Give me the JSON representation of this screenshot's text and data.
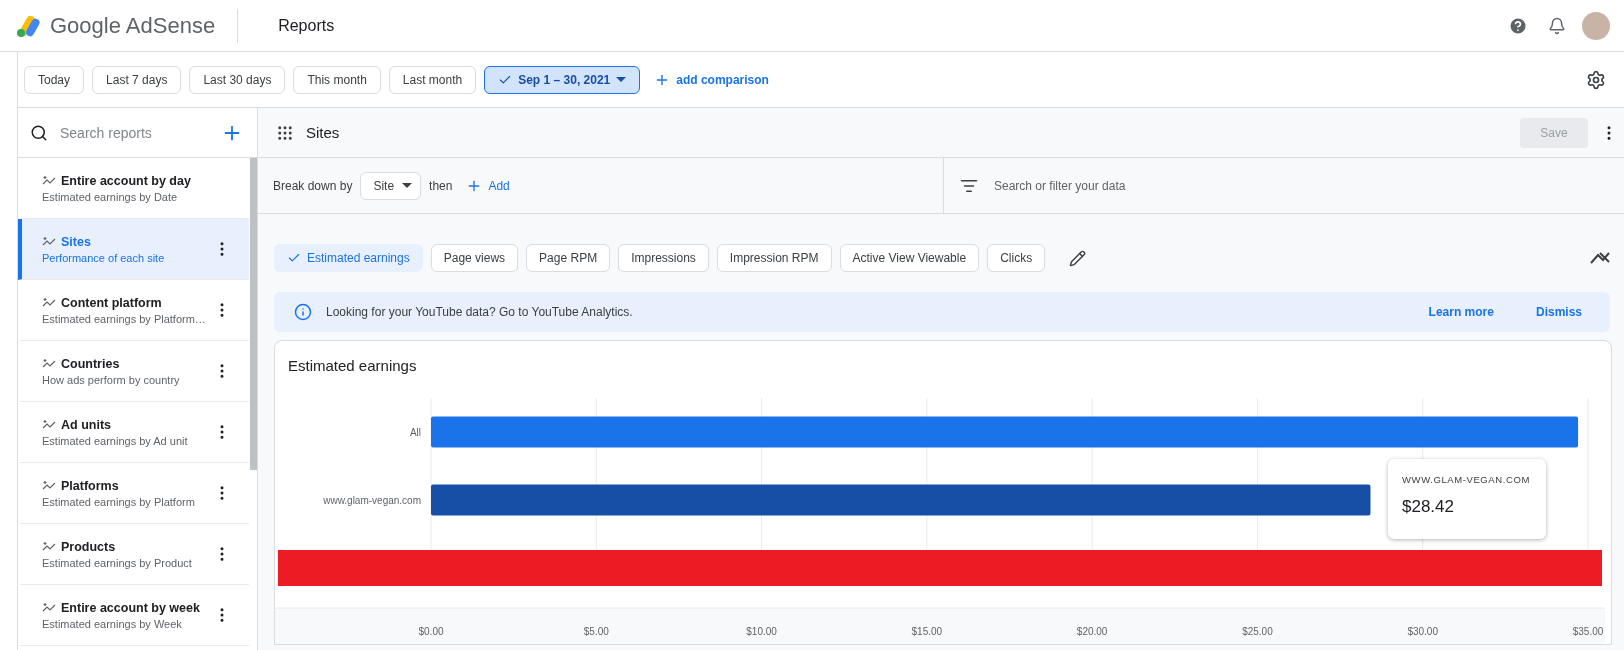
{
  "header": {
    "product": "Google AdSense",
    "page_title": "Reports"
  },
  "date_ranges": [
    {
      "label": "Today",
      "selected": false
    },
    {
      "label": "Last 7 days",
      "selected": false
    },
    {
      "label": "Last 30 days",
      "selected": false
    },
    {
      "label": "This month",
      "selected": false
    },
    {
      "label": "Last month",
      "selected": false
    },
    {
      "label": "Sep 1 – 30, 2021",
      "selected": true
    }
  ],
  "add_comparison": "add comparison",
  "sidebar": {
    "search": {
      "placeholder": "Search reports"
    },
    "items": [
      {
        "title": "Entire account by day",
        "subtitle": "Estimated earnings by Date",
        "selected": false,
        "has_menu": false
      },
      {
        "title": "Sites",
        "subtitle": "Performance of each site",
        "selected": true,
        "has_menu": true
      },
      {
        "title": "Content platform",
        "subtitle": "Estimated earnings by Platform…",
        "selected": false,
        "has_menu": true
      },
      {
        "title": "Countries",
        "subtitle": "How ads perform by country",
        "selected": false,
        "has_menu": true
      },
      {
        "title": "Ad units",
        "subtitle": "Estimated earnings by Ad unit",
        "selected": false,
        "has_menu": true
      },
      {
        "title": "Platforms",
        "subtitle": "Estimated earnings by Platform",
        "selected": false,
        "has_menu": true
      },
      {
        "title": "Products",
        "subtitle": "Estimated earnings by Product",
        "selected": false,
        "has_menu": true
      },
      {
        "title": "Entire account by week",
        "subtitle": "Estimated earnings by Week",
        "selected": false,
        "has_menu": true
      }
    ]
  },
  "report": {
    "title": "Sites",
    "save": {
      "label": "Save",
      "disabled": true
    },
    "breakdown": {
      "label": "Break down by",
      "value": "Site",
      "then": "then",
      "add": "Add"
    },
    "filter": {
      "placeholder": "Search or filter your data"
    },
    "metrics": [
      {
        "label": "Estimated earnings",
        "selected": true
      },
      {
        "label": "Page views",
        "selected": false
      },
      {
        "label": "Page RPM",
        "selected": false
      },
      {
        "label": "Impressions",
        "selected": false
      },
      {
        "label": "Impression RPM",
        "selected": false
      },
      {
        "label": "Active View Viewable",
        "selected": false
      },
      {
        "label": "Clicks",
        "selected": false
      }
    ],
    "banner": {
      "text": "Looking for your YouTube data? Go to YouTube Analytics.",
      "learn_more": "Learn more",
      "dismiss": "Dismiss"
    },
    "chart": {
      "redacted_row": true,
      "tooltip": {
        "title": "WWW.GLAM-VEGAN.COM",
        "value": "$28.42"
      },
      "chart_data": {
        "type": "bar",
        "orientation": "horizontal",
        "title": "Estimated earnings",
        "stacked": true,
        "grid": true,
        "categories": [
          "All",
          "www.glam-vegan.com"
        ],
        "series": [
          {
            "color": "#1a73e8",
            "values": [
              34.7,
              null
            ]
          },
          {
            "color": "#174ea6",
            "values": [
              null,
              28.42
            ]
          }
        ],
        "xlim": [
          0,
          35
        ],
        "xticks": [
          {
            "value": 0,
            "label": "$0.00"
          },
          {
            "value": 5,
            "label": "$5.00"
          },
          {
            "value": 10,
            "label": "$10.00"
          },
          {
            "value": 15,
            "label": "$15.00"
          },
          {
            "value": 20,
            "label": "$20.00"
          },
          {
            "value": 25,
            "label": "$25.00"
          },
          {
            "value": 30,
            "label": "$30.00"
          },
          {
            "value": 35,
            "label": "$35.00"
          }
        ]
      }
    }
  }
}
